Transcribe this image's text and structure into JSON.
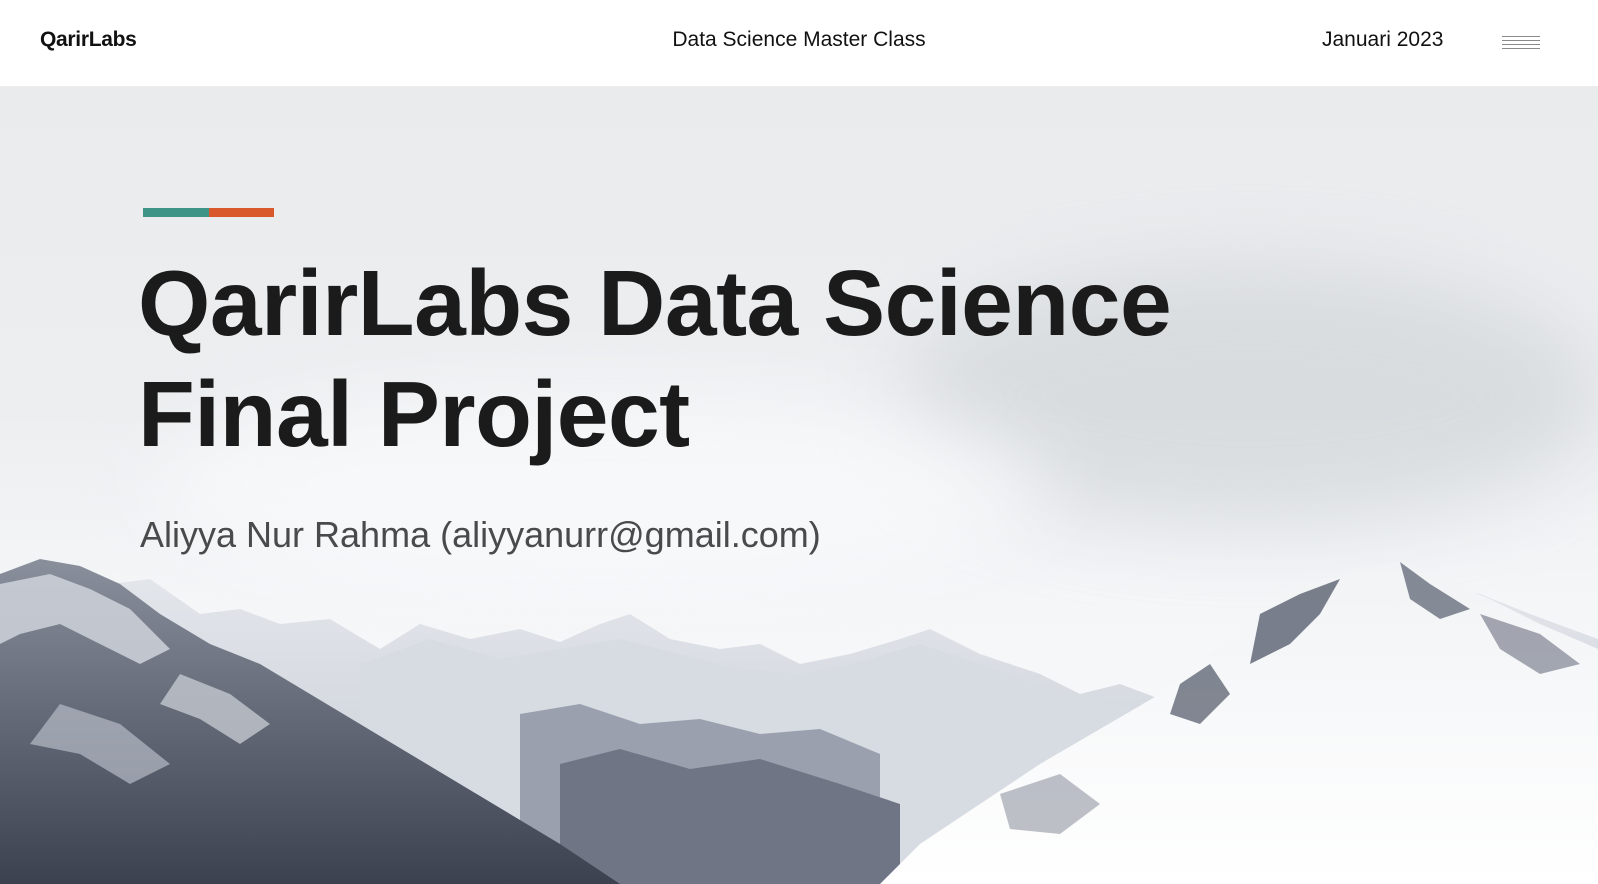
{
  "header": {
    "brand": "QarirLabs",
    "course": "Data Science Master Class",
    "date": "Januari 2023",
    "menu_icon": "hamburger-menu-icon"
  },
  "slide": {
    "title_line1": "QarirLabs Data Science",
    "title_line2": "Final Project",
    "author": "Aliyya Nur Rahma (aliyyanurr@gmail.com)",
    "background": "snowy mountain range photo"
  },
  "colors": {
    "accent_teal": "#3f9488",
    "accent_orange": "#d9592c",
    "title": "#1b1b1b",
    "subtitle": "#4a4a4a"
  }
}
